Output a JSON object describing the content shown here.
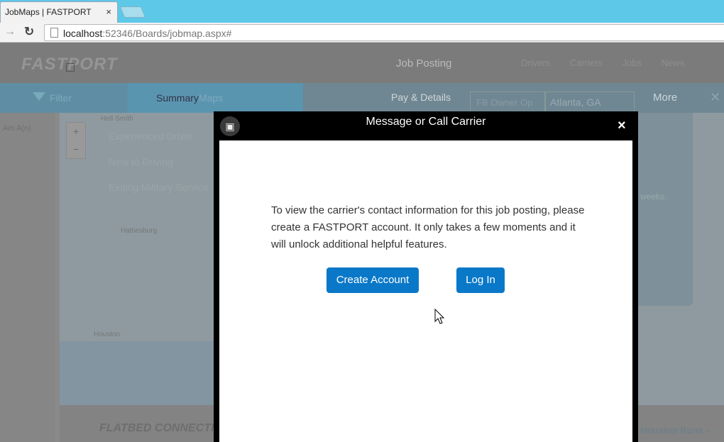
{
  "browser": {
    "tab_title": "JobMaps | FASTPORT",
    "tab_close": "×",
    "url_host": "localhost",
    "url_path": ":52346/Boards/jobmap.aspx#"
  },
  "page": {
    "logo": "FASTPORT",
    "header_title": "Job Posting",
    "topnav": [
      "Drivers",
      "Carriers",
      "Jobs",
      "News"
    ],
    "filter_label": "Filter",
    "summary_label": "Summary",
    "maps_label": "Maps",
    "pay_details_label": "Pay & Details",
    "location_ghost": "FB Owner Op",
    "location_value": "Atlanta, GA",
    "more_label": "More",
    "left_text": "Am A(n)",
    "map_items": [
      "Experienced Driver",
      "New to Driving",
      "Exiting Military Service"
    ],
    "map_labels": [
      "Hattiesburg",
      "Houston",
      "Hell Smith"
    ],
    "right_panel_text": "weeks.",
    "footer_logo": "FLATBED CONNECTIONS",
    "footer_right": "Houston Runs –"
  },
  "modal": {
    "title": "Message or Call Carrier",
    "close_glyph": "×",
    "message": "To view the carrier's contact information for this job posting, please create a FASTPORT account. It only takes a few moments and it will unlock additional helpful features.",
    "create_account_label": "Create Account",
    "login_label": "Log In"
  }
}
